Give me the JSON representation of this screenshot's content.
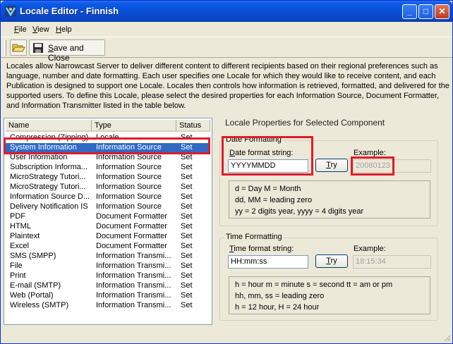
{
  "window": {
    "title": "Locale Editor - Finnish",
    "buttons": {
      "minimize": "_",
      "maximize": "□",
      "close": "✕"
    }
  },
  "menu": {
    "file": {
      "u": "F",
      "rest": "ile"
    },
    "view": {
      "u": "V",
      "rest": "iew"
    },
    "help": {
      "u": "H",
      "rest": "elp"
    }
  },
  "toolbar": {
    "save_close": {
      "u": "S",
      "rest": "ave and Close"
    }
  },
  "description": "Locales allow Narrowcast Server to deliver different content to different recipients based on their regional preferences such as language, number and date formatting. Each user specifies one Locale for which they would like to receive content, and each Publication is designed to support one Locale. Locales then controls how information is retrieved, formatted, and delivered for the supported users. To define this Locale, please select the desired properties for each Information Source, Document Formatter, and Information Transmitter listed in the table below.",
  "table": {
    "headers": [
      "Name",
      "Type",
      "Status"
    ],
    "rows": [
      [
        "Compression (Zipping)",
        "Locale",
        "Set"
      ],
      [
        "System Information",
        "Information Source",
        "Set"
      ],
      [
        "User Information",
        "Information Source",
        "Set"
      ],
      [
        "Subscription Informa...",
        "Information Source",
        "Set"
      ],
      [
        "MicroStrategy Tutori...",
        "Information Source",
        "Set"
      ],
      [
        "MicroStrategy Tutori...",
        "Information Source",
        "Set"
      ],
      [
        "Information Source D...",
        "Information Source",
        "Set"
      ],
      [
        "Delivery Notification IS",
        "Information Source",
        "Set"
      ],
      [
        "PDF",
        "Document Formatter",
        "Set"
      ],
      [
        "HTML",
        "Document Formatter",
        "Set"
      ],
      [
        "Plaintext",
        "Document Formatter",
        "Set"
      ],
      [
        "Excel",
        "Document Formatter",
        "Set"
      ],
      [
        "SMS (SMPP)",
        "Information Transmi...",
        "Set"
      ],
      [
        "File",
        "Information Transmi...",
        "Set"
      ],
      [
        "Print",
        "Information Transmi...",
        "Set"
      ],
      [
        "E-mail (SMTP)",
        "Information Transmi...",
        "Set"
      ],
      [
        "Web (Portal)",
        "Information Transmi...",
        "Set"
      ],
      [
        "Wireless (SMTP)",
        "Information Transmi...",
        "Set"
      ]
    ],
    "selected_index": 1
  },
  "properties": {
    "title": "Locale Properties for Selected Component",
    "date": {
      "group_title": "Date Formatting",
      "label": {
        "u": "D",
        "rest": "ate format string:"
      },
      "value": "YYYYMMDD",
      "try": {
        "u": "T",
        "rest": "ry"
      },
      "example_label": "Example:",
      "example_value": "20080123",
      "hints": [
        "d = Day    M = Month",
        "dd, MM = leading zero",
        "yy = 2 digits year, yyyy = 4 digits year"
      ]
    },
    "time": {
      "group_title": "Time Formatting",
      "label": {
        "u": "T",
        "rest": "ime format string:"
      },
      "value": "HH:mm:ss",
      "try": {
        "u": "T",
        "rest": "ry"
      },
      "example_label": "Example:",
      "example_value": "18:15:34",
      "hints": [
        "h = hour     m = minute     s = second    tt = am or pm",
        "hh, mm, ss = leading zero",
        "h = 12 hour,  H = 24 hour"
      ]
    }
  },
  "colors": {
    "title_bar": "#0a4fd8",
    "selection": "#316ac5",
    "highlight_box": "#e01c2c"
  }
}
